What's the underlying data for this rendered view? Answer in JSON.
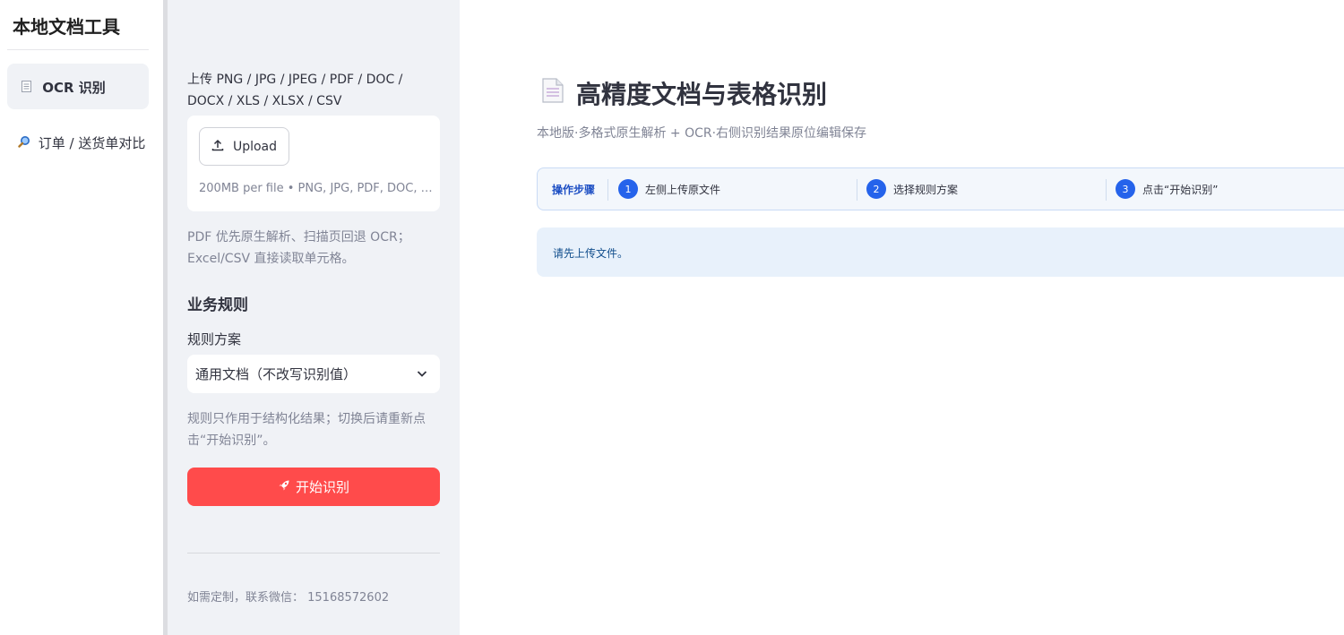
{
  "nav": {
    "title": "本地文档工具",
    "items": [
      {
        "icon": "document-icon",
        "label": "OCR 识别"
      },
      {
        "icon": "magnifier-icon",
        "label": "订单 / 送货单对比"
      }
    ]
  },
  "sidebar": {
    "upload_label": "上传 PNG / JPG / JPEG / PDF / DOC / DOCX / XLS / XLSX / CSV",
    "upload_button": "Upload",
    "upload_hint": "200MB per file • PNG, JPG, PDF, DOC, D…",
    "upload_caption": "PDF 优先原生解析、扫描页回退 OCR；Excel/CSV 直接读取单元格。",
    "rules_heading": "业务规则",
    "rules_select_label": "规则方案",
    "rules_select_value": "通用文档（不改写识别值）",
    "rules_caption": "规则只作用于结构化结果；切换后请重新点击“开始识别”。",
    "start_button": "开始识别",
    "contact": "如需定制，联系微信：  15168572602"
  },
  "main": {
    "title": "高精度文档与表格识别",
    "subtitle": "本地版·多格式原生解析 + OCR·右侧识别结果原位编辑保存",
    "steps_label": "操作步骤",
    "steps": [
      {
        "num": "1",
        "text": "左侧上传原文件"
      },
      {
        "num": "2",
        "text": "选择规则方案"
      },
      {
        "num": "3",
        "text": "点击“开始识别”"
      }
    ],
    "info_message": "请先上传文件。"
  },
  "colors": {
    "primary": "#ff4b4b",
    "step_accent": "#2563eb",
    "sidebar_bg": "#f0f2f6",
    "info_bg": "#e8f1fb"
  }
}
